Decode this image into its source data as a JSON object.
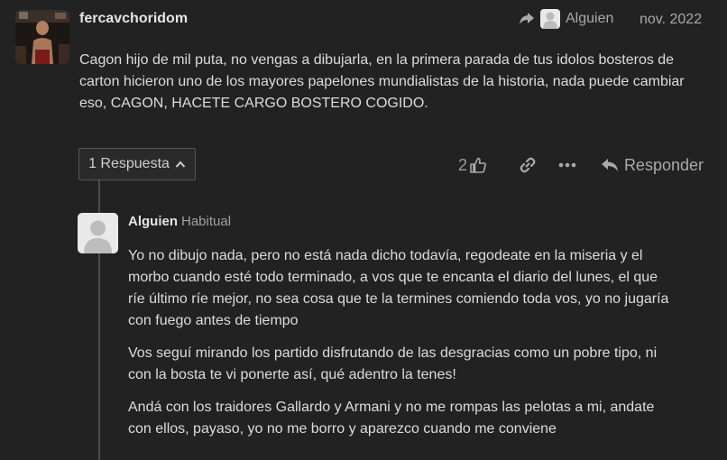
{
  "post": {
    "username": "fercavchoridom",
    "reply_to_user": "Alguien",
    "date": "nov. 2022",
    "body": "Cagon hijo de mil puta, no vengas a dibujarla, en la primera parada de tus idolos bosteros de carton hicieron uno de los mayores papelones mundialistas de la historia, nada puede cambiar eso, CAGON, HACETE CARGO BOSTERO COGIDO."
  },
  "actions": {
    "replies_label": "1 Respuesta",
    "like_count": "2",
    "reply_label": "Responder"
  },
  "reply": {
    "username": "Alguien",
    "user_title": "Habitual",
    "paragraphs": [
      "Yo no dibujo nada, pero no está nada dicho todavía, regodeate en la miseria y el morbo cuando esté todo terminado, a vos que te encanta el diario del lunes, el que ríe último ríe mejor, no sea cosa que te la termines comiendo toda vos, yo no jugaría con fuego antes de tiempo",
      "Vos seguí mirando los partido disfrutando de las desgracias como un pobre tipo, ni con la bosta te vi ponerte así, qué adentro la tenes!",
      "Andá con los traidores Gallardo y Armani y no me rompas las pelotas a mi, andate con ellos, payaso, yo no me borro y aparezco cuando me conviene"
    ]
  },
  "icons": {
    "reply_to": "share-arrow-icon",
    "chevron": "chevron-up-icon",
    "like": "thumbs-up-icon",
    "link": "link-icon",
    "more": "ellipsis-icon",
    "reply": "reply-arrow-icon"
  },
  "colors": {
    "background": "#222222",
    "text": "#dcdcdc",
    "muted": "#a9a9a9"
  }
}
